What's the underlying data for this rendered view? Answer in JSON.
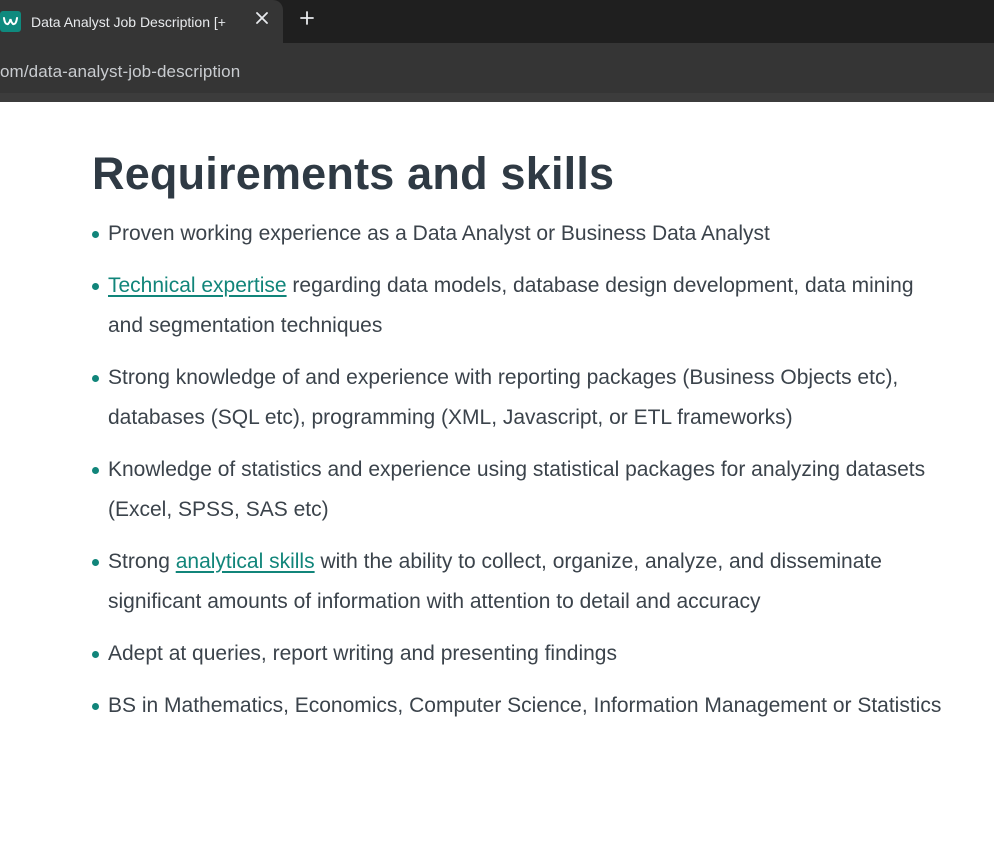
{
  "browser": {
    "tab_title": "Data Analyst Job Description [+",
    "url": "om/data-analyst-job-description",
    "favicon_color": "#0f8a7e"
  },
  "page": {
    "heading": "Requirements and skills",
    "link_color": "#11857a",
    "items": [
      {
        "pre": "",
        "link": "",
        "post": "Proven working experience as a Data Analyst or Business Data Analyst"
      },
      {
        "pre": "",
        "link": "Technical expertise",
        "post": " regarding data models, database design development, data mining and segmentation techniques"
      },
      {
        "pre": "",
        "link": "",
        "post": "Strong knowledge of and experience with reporting packages (Business Objects etc), databases (SQL etc), programming (XML, Javascript, or ETL frameworks)"
      },
      {
        "pre": "",
        "link": "",
        "post": "Knowledge of statistics and experience using statistical packages for analyzing datasets (Excel, SPSS, SAS etc)"
      },
      {
        "pre": "Strong ",
        "link": "analytical skills",
        "post": " with the ability to collect, organize, analyze, and disseminate significant amounts of information with attention to detail and accuracy"
      },
      {
        "pre": "",
        "link": "",
        "post": "Adept at queries, report writing and presenting findings"
      },
      {
        "pre": "",
        "link": "",
        "post": "BS in Mathematics, Economics, Computer Science, Information Management or Statistics"
      }
    ]
  }
}
